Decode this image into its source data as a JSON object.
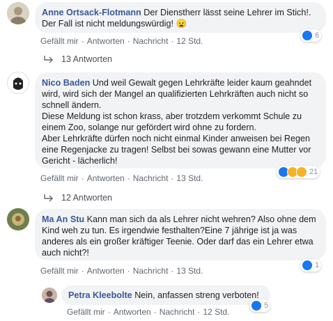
{
  "comments": [
    {
      "author": "Anne Ortsack-Flotmann",
      "text": "Der Dienstherr lässt seine Lehrer im Stich!. Der Fall ist nicht meldungswürdig! 😦",
      "actions": {
        "like": "Gefällt mir",
        "reply": "Antworten",
        "message": "Nachricht",
        "time": "12 Std."
      },
      "reaction_count": "6",
      "reaction_icons": [
        "like-icon"
      ],
      "replies_label": "13 Antworten"
    },
    {
      "author": "Nico Baden",
      "text": "Und weil Gewalt gegen Lehrkräfte leider kaum geahndet wird, wird sich der Mangel an qualifizierten Lehrkräften auch nicht so schnell ändern.\nDiese Meldung ist schon krass, aber trotzdem verkommt Schule zu einem Zoo, solange nur gefördert wird ohne zu fordern.\nAber Lehrkräfte dürfen noch nicht einmal Kinder anweisen bei Regen eine Regenjacke zu tragen! Selbst bei sowas gewann eine Mutter vor Gericht - lächerlich!",
      "actions": {
        "like": "Gefällt mir",
        "reply": "Antworten",
        "message": "Nachricht",
        "time": "13 Std."
      },
      "reaction_count": "21",
      "reaction_icons": [
        "like-icon",
        "wow-icon",
        "sad-icon"
      ],
      "replies_label": "12 Antworten"
    },
    {
      "author": "Ma An Stu",
      "text": "Kann man sich da als Lehrer nicht wehren? Also ohne dem Kind weh zu tun. Es irgendwie festhalten?Eine 7 jährige ist ja was anderes als ein großer kräftiger Teenie. Oder darf das ein Lehrer etwa auch nicht?!",
      "actions": {
        "like": "Gefällt mir",
        "reply": "Antworten",
        "message": "Nachricht",
        "time": "13 Std."
      },
      "reaction_count": "1",
      "reaction_icons": [
        "like-icon"
      ]
    }
  ],
  "reply": {
    "author": "Petra Kleebolte",
    "text": "Nein, anfassen streng verboten!",
    "actions": {
      "like": "Gefällt mir",
      "reply": "Antworten",
      "message": "Nachricht",
      "time": "12 Std."
    },
    "reaction_count": "5",
    "reaction_icons": [
      "like-icon"
    ]
  },
  "colors": {
    "link": "#385898",
    "bubble": "#f2f3f5",
    "like": "#1877f2",
    "wow": "#f7b125"
  }
}
